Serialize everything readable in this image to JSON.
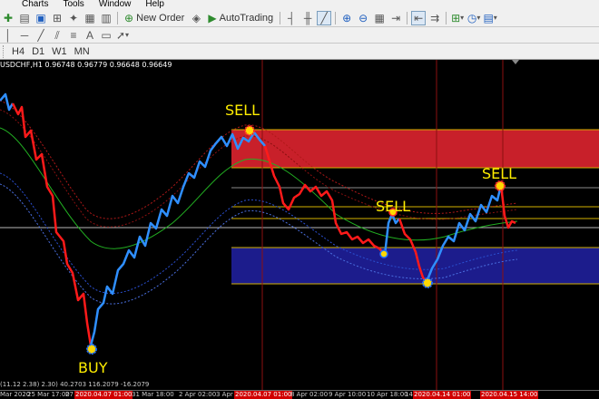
{
  "menu": [
    "",
    "Charts",
    "Tools",
    "Window",
    "Help"
  ],
  "toolbar": {
    "new_order_label": "New Order",
    "autotrading_label": "AutoTrading"
  },
  "timeframes": [
    "H4",
    "D1",
    "W1",
    "MN"
  ],
  "chart": {
    "title": "USDCHF,H1  0.96748 0.96779 0.96648 0.96649",
    "signals": {
      "buy": "BUY",
      "sell1": "SELL",
      "sell2": "SELL",
      "sell3": "SELL"
    }
  },
  "axis_labels": [
    "Mar 2020",
    "25 Mar 17:00",
    "27",
    "31 Mar 18:00",
    "2 Apr 02:00",
    "3 Apr 10:00",
    "8 Apr 02:00",
    "9 Apr 10:00",
    "10 Apr 18:00",
    "14"
  ],
  "axis_highlights": [
    "2020.04.07 01:00",
    "2020.04.14 01:00",
    "2020.04.15 14:00"
  ],
  "indicator_readout": "(11.12 2.38) 2.30) 40.2703 116.2079 -16.2079",
  "colors": {
    "bull": "#2f8fff",
    "bear": "#ff1a1a",
    "sell_zone": "#c8202a",
    "buy_zone": "#1c1c8c",
    "level": "#d4b200",
    "signal_text": "#ffee00"
  }
}
